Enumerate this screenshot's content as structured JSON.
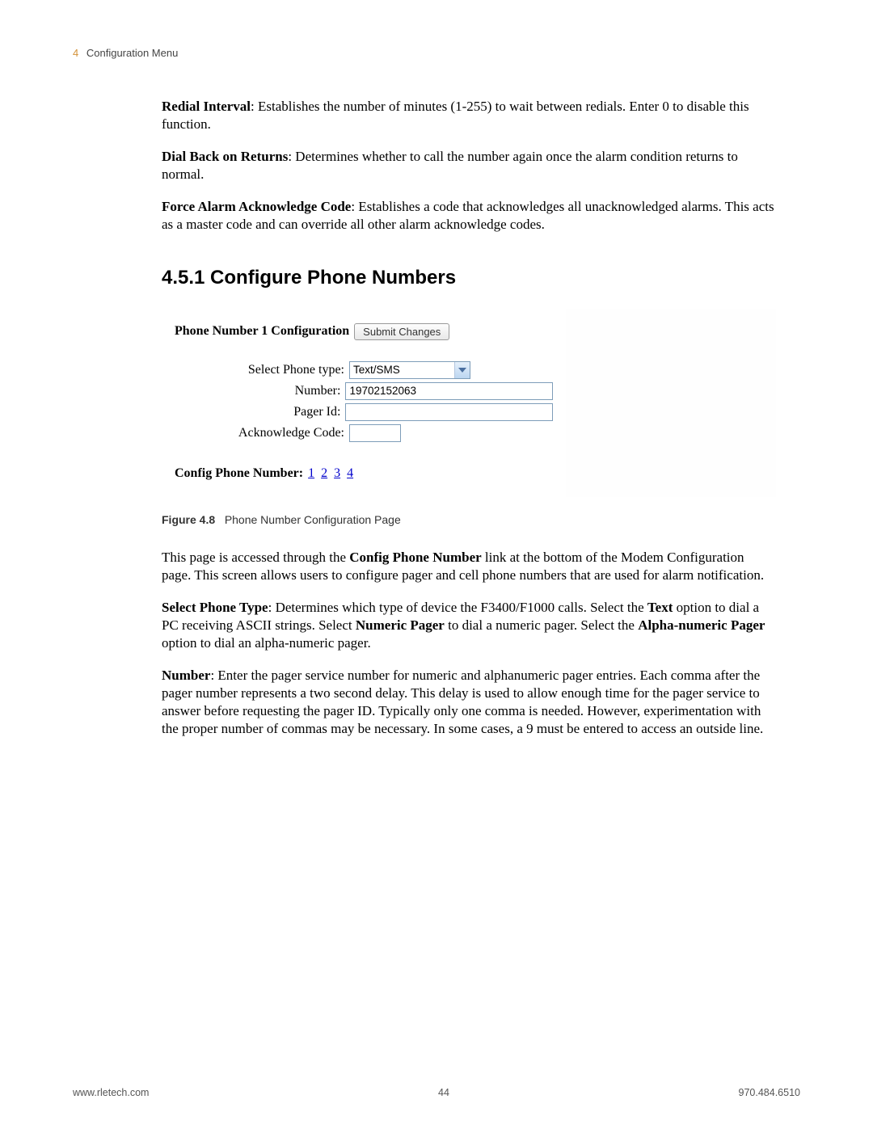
{
  "header": {
    "chapter_number": "4",
    "chapter_title": "Configuration Menu"
  },
  "paragraphs": {
    "redial_label": "Redial Interval",
    "redial_text": ": Establishes the number of minutes (1-255) to wait between redials. Enter 0 to disable this function.",
    "dialback_label": "Dial Back on Returns",
    "dialback_text": ": Determines whether to call the number again once the alarm condition returns to normal.",
    "force_label": "Force Alarm Acknowledge Code",
    "force_text": ": Establishes a code that acknowledges all unacknowledged alarms. This acts as a master code and can override all other alarm acknowledge codes."
  },
  "section_heading": "4.5.1  Configure Phone Numbers",
  "figure": {
    "title": "Phone Number 1 Configuration",
    "submit_label": "Submit Changes",
    "labels": {
      "select_phone_type": "Select Phone type:",
      "number": "Number:",
      "pager_id": "Pager Id:",
      "ack_code": "Acknowledge Code:"
    },
    "values": {
      "phone_type": "Text/SMS",
      "number": "19702152063",
      "pager_id": "",
      "ack_code": ""
    },
    "config_links_label": "Config Phone Number",
    "config_links": [
      "1",
      "2",
      "3",
      "4"
    ]
  },
  "figure_caption": {
    "label": "Figure 4.8",
    "text": "Phone Number Configuration Page"
  },
  "body_after": {
    "intro_pre": "This page is accessed through the ",
    "intro_bold": "Config Phone Number",
    "intro_post": " link at the bottom of the Modem Configuration page. This screen allows users to configure pager and cell phone numbers that are used for alarm notification.",
    "select_label": "Select Phone Type",
    "select_text1": ": Determines which type of device the F3400/F1000 calls. Select the ",
    "select_bold_text": "Text",
    "select_text2": " option to dial a PC receiving ASCII strings. Select ",
    "select_bold_numeric": "Numeric Pager",
    "select_text3": " to dial a numeric pager. Select the ",
    "select_bold_alpha": "Alpha-numeric Pager",
    "select_text4": " option to dial an alpha-numeric pager.",
    "number_label": "Number",
    "number_text": ": Enter the pager service number for numeric and alphanumeric pager entries. Each comma after the pager number represents a two second delay. This delay is used to allow enough time for the pager service to answer before requesting the pager ID. Typically only one comma is needed. However, experimentation with the proper number of commas may be necessary. In some cases, a 9 must be entered to access an outside line."
  },
  "footer": {
    "left": "www.rletech.com",
    "center": "44",
    "right": "970.484.6510"
  }
}
